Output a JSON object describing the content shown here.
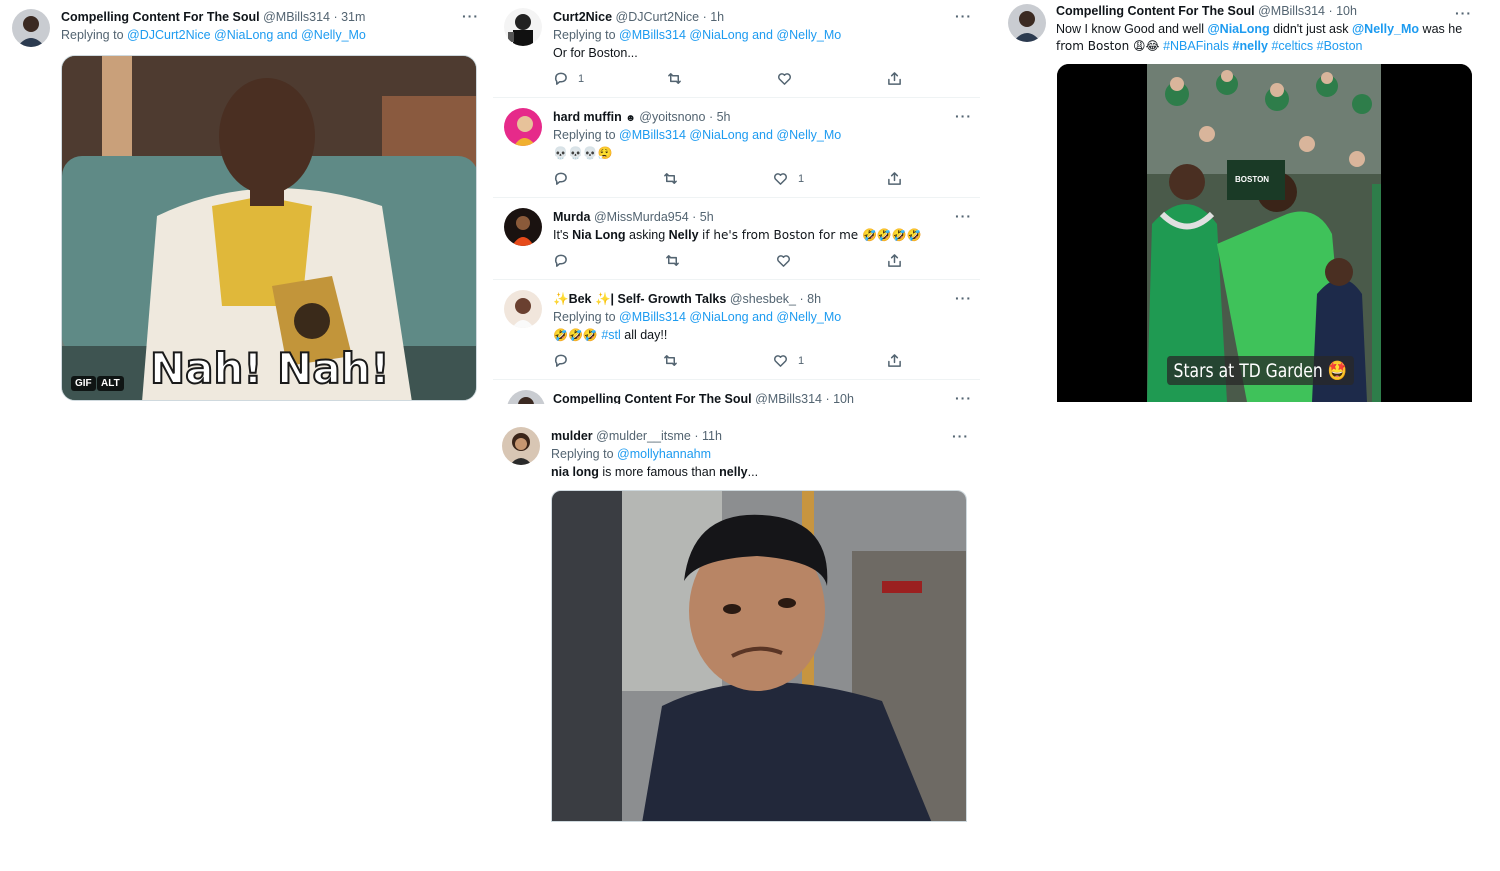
{
  "left_tweet": {
    "name": "Compelling Content For The Soul",
    "handle": "@MBills314",
    "time": "· 31m",
    "reply_prefix": "Replying to",
    "reply_targets": "@DJCurt2Nice @NiaLong and @Nelly_Mo",
    "gif_caption": "Nah! Nah!",
    "gif_badge": "GIF",
    "alt_badge": "ALT"
  },
  "middle_tweets": [
    {
      "name": "Curt2Nice",
      "handle": "@DJCurt2Nice",
      "time": "· 1h",
      "reply_prefix": "Replying to",
      "reply_targets": "@MBills314 @NiaLong and @Nelly_Mo",
      "text": "Or for Boston...",
      "reply_count": "1",
      "retweet_count": "",
      "like_count": ""
    },
    {
      "name": "hard muffin",
      "name_suffix": "☻",
      "handle": "@yoitsnono",
      "time": "· 5h",
      "reply_prefix": "Replying to",
      "reply_targets": "@MBills314 @NiaLong and @Nelly_Mo",
      "text": "💀💀💀😮‍💨",
      "reply_count": "",
      "retweet_count": "",
      "like_count": "1"
    },
    {
      "name": "Murda",
      "handle": "@MissMurda954",
      "time": "· 5h",
      "text_prefix": "It's",
      "text_bold_1": "Nia Long",
      "text_mid": "asking",
      "text_bold_2": "Nelly",
      "text_suffix": "if he's from Boston for me 🤣🤣🤣🤣",
      "reply_count": "",
      "retweet_count": "",
      "like_count": ""
    },
    {
      "name": "✨Bek ✨| Self- Growth Talks",
      "handle": "@shesbek_",
      "time": "· 8h",
      "reply_prefix": "Replying to",
      "reply_targets": "@MBills314 @NiaLong and @Nelly_Mo",
      "text_prefix": "🤣🤣🤣",
      "text_tag": "#stl",
      "text_suffix": "all day!!",
      "reply_count": "",
      "retweet_count": "",
      "like_count": "1"
    },
    {
      "name": "Compelling Content For The Soul",
      "handle": "@MBills314",
      "time": "· 10h"
    }
  ],
  "mulder_tweet": {
    "name": "mulder",
    "handle": "@mulder__itsme",
    "time": "· 11h",
    "reply_prefix": "Replying to",
    "reply_targets": "@mollyhannahm",
    "text_bold_1": "nia long",
    "text_mid": "is more famous than",
    "text_bold_2": "nelly",
    "text_suffix": "..."
  },
  "right_tweet": {
    "name": "Compelling Content For The Soul",
    "handle": "@MBills314",
    "time": "· 10h",
    "line1_prefix": "Now I know Good and well",
    "line1_mention1": "@NiaLong",
    "line1_mid": "didn't just ask",
    "line1_mention2": "@Nelly_Mo",
    "line1_suffix": "was he",
    "line2_prefix": "from Boston 😩😂",
    "tag1": "#NBAFinals",
    "tag2": "#nelly",
    "tag3": "#celtics",
    "tag4": "#Boston",
    "video_caption": "Stars at TD Garden 🤩",
    "jersey_text": "BOSTON"
  },
  "icons": [
    "more-icon",
    "reply-icon",
    "retweet-icon",
    "like-icon",
    "share-icon"
  ],
  "colors": {
    "link": "#1d9bf0",
    "muted": "#536471",
    "text": "#0f1419",
    "divider": "#eff3f4"
  }
}
